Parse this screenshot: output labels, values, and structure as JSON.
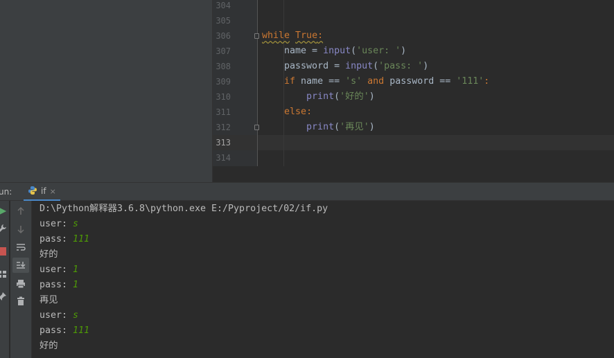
{
  "editor": {
    "line_numbers": [
      "304",
      "305",
      "306",
      "307",
      "308",
      "309",
      "310",
      "311",
      "312",
      "313",
      "314"
    ],
    "current_line": "313",
    "code": {
      "l306": {
        "kw": "while",
        "sp": " ",
        "kw2": "True",
        "colon": ":"
      },
      "l307": {
        "indent": "    ",
        "a": "name = ",
        "fn": "input",
        "b": "(",
        "str": "'user: '",
        "c": ")"
      },
      "l308": {
        "indent": "    ",
        "a": "password = ",
        "fn": "input",
        "b": "(",
        "str": "'pass: '",
        "c": ")"
      },
      "l309": {
        "indent": "    ",
        "kw": "if",
        "a": " name == ",
        "str1": "'s'",
        "sp": " ",
        "kw2": "and",
        "b": " password == ",
        "str2": "'111'",
        "colon": ":"
      },
      "l310": {
        "indent": "        ",
        "fn": "print",
        "b": "(",
        "str": "'好的'",
        "c": ")"
      },
      "l311": {
        "indent": "    ",
        "kw": "else",
        "colon": ":"
      },
      "l312": {
        "indent": "        ",
        "fn": "print",
        "b": "(",
        "str": "'再见'",
        "c": ")"
      }
    }
  },
  "run_panel": {
    "label": "un:",
    "tab_label": "if",
    "tab_close": "×"
  },
  "console": {
    "command": "D:\\Python解释器3.6.8\\python.exe E:/Pyproject/02/if.py",
    "lines": [
      {
        "prompt": "user: ",
        "input": "s"
      },
      {
        "prompt": "pass: ",
        "input": "111"
      },
      {
        "prompt": "好的",
        "input": ""
      },
      {
        "prompt": "user: ",
        "input": "1"
      },
      {
        "prompt": "pass: ",
        "input": "1"
      },
      {
        "prompt": "再见",
        "input": ""
      },
      {
        "prompt": "user: ",
        "input": "s"
      },
      {
        "prompt": "pass: ",
        "input": "111"
      },
      {
        "prompt": "好的",
        "input": ""
      }
    ]
  },
  "icons": {
    "left_toolbar": [
      "rerun-icon",
      "wrench-icon",
      "stop-icon",
      "layout-icon",
      "pin-icon"
    ],
    "second_toolbar": [
      "arrow-up-icon",
      "arrow-down-icon",
      "soft-wrap-icon",
      "scroll-to-end-icon",
      "print-icon",
      "trash-icon"
    ]
  },
  "colors": {
    "keyword": "#cc7832",
    "builtin": "#8888c6",
    "string": "#6a8759",
    "user_input": "#4e9a06",
    "tab_underline": "#4a88c7"
  }
}
